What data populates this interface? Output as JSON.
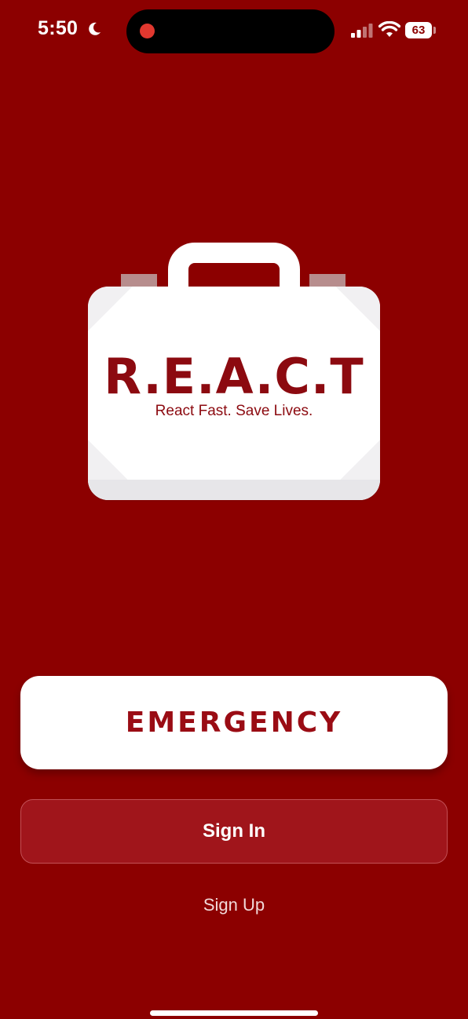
{
  "status_bar": {
    "time": "5:50",
    "battery": "63",
    "icons": [
      "moon-icon",
      "cellular-signal-icon",
      "wifi-icon",
      "battery-icon"
    ]
  },
  "logo": {
    "title": "R.E.A.C.T",
    "tagline": "React Fast. Save Lives.",
    "icon": "briefcase-icon"
  },
  "actions": {
    "emergency_label": "EMERGENCY",
    "signin_label": "Sign In",
    "signup_label": "Sign Up"
  },
  "colors": {
    "background": "#8c0000",
    "brand_red": "#8c0a10",
    "signin_fill": "#a0151b",
    "white": "#ffffff"
  }
}
